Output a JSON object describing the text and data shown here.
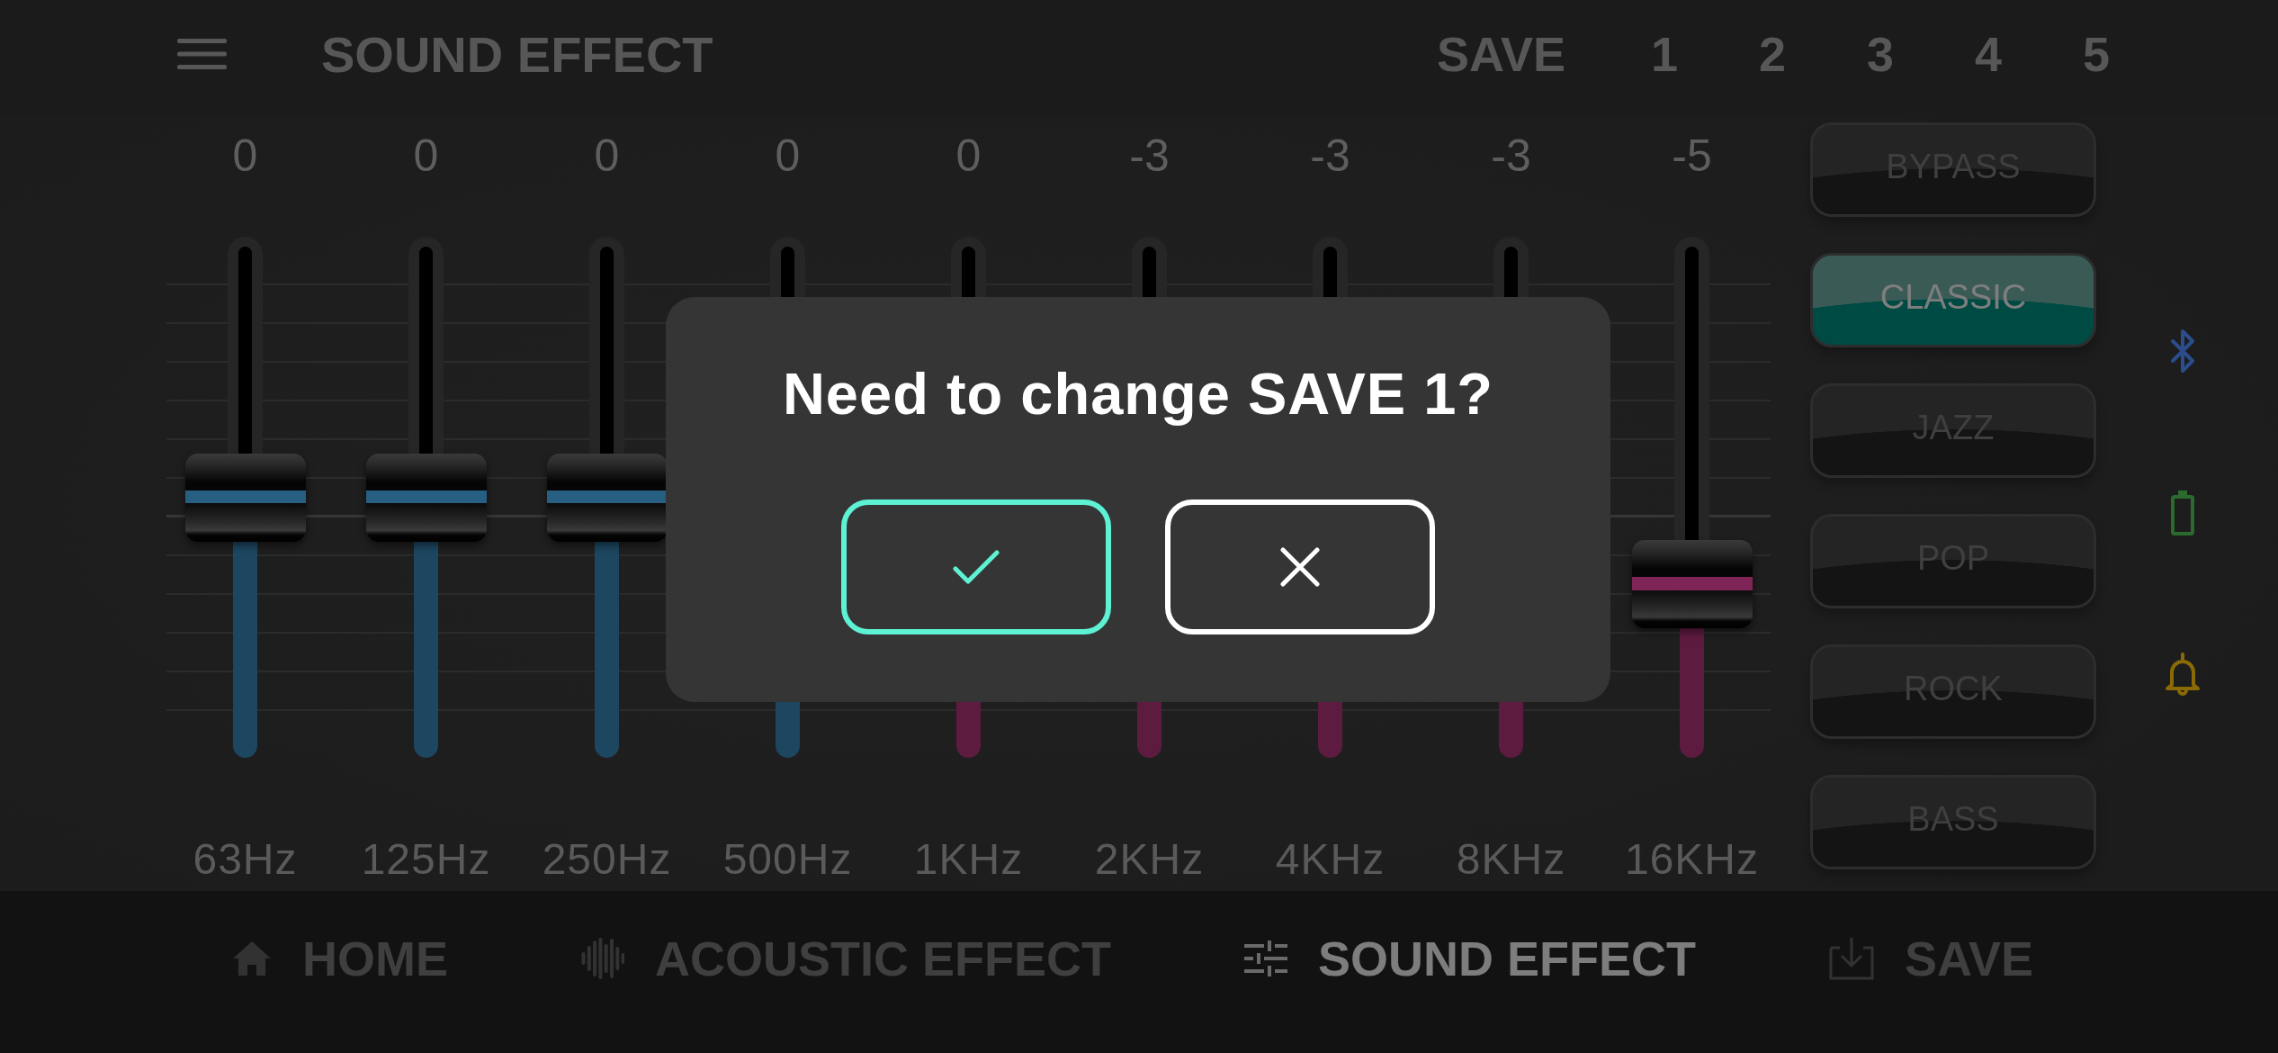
{
  "top_bar": {
    "title": "SOUND EFFECT",
    "save_label": "SAVE",
    "slots": [
      {
        "label": "1",
        "selected": false
      },
      {
        "label": "2",
        "selected": false
      },
      {
        "label": "3",
        "selected": false
      },
      {
        "label": "4",
        "selected": false
      },
      {
        "label": "5",
        "selected": false
      }
    ]
  },
  "equalizer": {
    "faders": [
      {
        "value": "0",
        "frequency": "63Hz",
        "color": "#1d4660",
        "level": 0.5
      },
      {
        "value": "0",
        "frequency": "125Hz",
        "color": "#1d4660",
        "level": 0.5
      },
      {
        "value": "0",
        "frequency": "250Hz",
        "color": "#1d4660",
        "level": 0.5
      },
      {
        "value": "0",
        "frequency": "500Hz",
        "color": "#1d4660"
      },
      {
        "value": "0",
        "frequency": "1KHz",
        "color": "#5e1b40"
      },
      {
        "value": "-3",
        "frequency": "2KHz",
        "color": "#5e1b40"
      },
      {
        "value": "-3",
        "frequency": "4KHz",
        "color": "#5e1b40"
      },
      {
        "value": "-3",
        "frequency": "8KHz",
        "color": "#5e1b40"
      },
      {
        "value": "-5",
        "frequency": "16KHz",
        "color": "#5e1b40",
        "level": 0.333
      }
    ]
  },
  "presets": [
    {
      "label": "BYPASS",
      "selected": false
    },
    {
      "label": "CLASSIC",
      "selected": true
    },
    {
      "label": "JAZZ",
      "selected": false
    },
    {
      "label": "POP",
      "selected": false
    },
    {
      "label": "ROCK",
      "selected": false
    },
    {
      "label": "BASS",
      "selected": false
    }
  ],
  "dialog": {
    "title": "Need to change SAVE 1?",
    "buttons": [
      {
        "kind": "confirm"
      },
      {
        "kind": "cancel"
      }
    ]
  },
  "bottom_nav": [
    {
      "label": "HOME",
      "selected": false
    },
    {
      "label": "ACOUSTIC EFFECT",
      "selected": false
    },
    {
      "label": "SOUND EFFECT",
      "selected": true
    },
    {
      "label": "SAVE",
      "selected": false
    }
  ]
}
